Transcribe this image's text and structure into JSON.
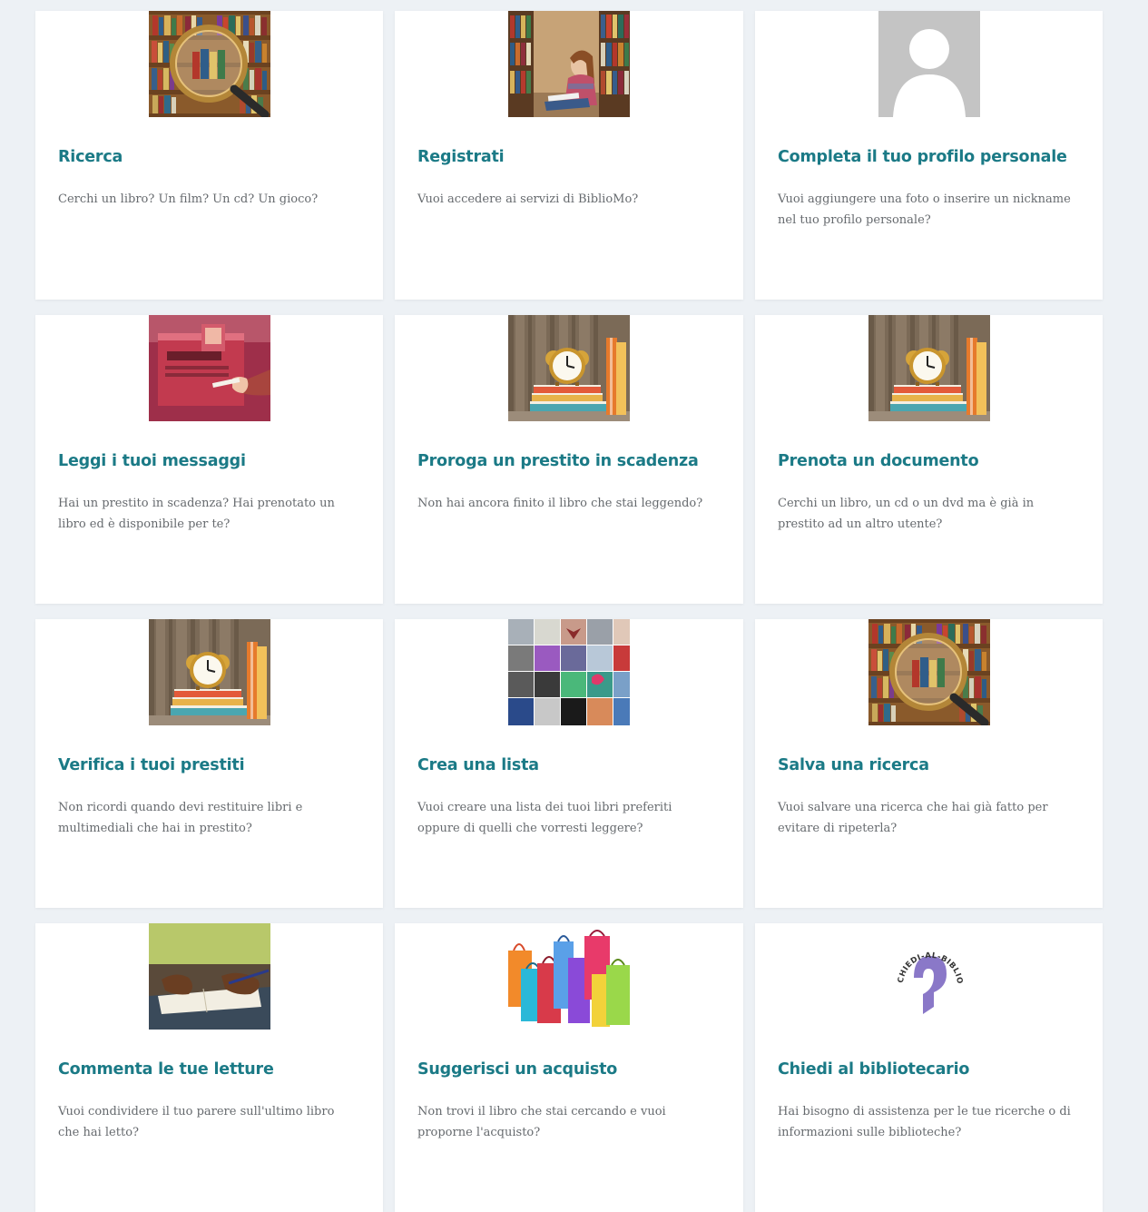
{
  "cards": [
    {
      "title": "Ricerca",
      "description": "Cerchi un libro? Un film? Un cd? Un gioco?",
      "icon": "bookshelf-magnifier-image"
    },
    {
      "title": "Registrati",
      "description": "Vuoi accedere ai servizi di BiblioMo?",
      "icon": "woman-reading-in-library-image"
    },
    {
      "title": "Completa il tuo profilo personale",
      "description": "Vuoi aggiungere una foto o inserire un nickname nel tuo profilo personale?",
      "icon": "default-avatar-image"
    },
    {
      "title": "Leggi i tuoi messaggi",
      "description": "Hai un prestito in scadenza? Hai prenotato un libro ed è disponibile per te?",
      "icon": "red-mailbox-image"
    },
    {
      "title": "Proroga un prestito in scadenza",
      "description": "Non hai ancora finito il libro che stai leggendo?",
      "icon": "alarm-clock-on-books-image"
    },
    {
      "title": "Prenota un documento",
      "description": "Cerchi un libro, un cd o un dvd ma è già in prestito ad un altro utente?",
      "icon": "alarm-clock-on-books-image"
    },
    {
      "title": "Verifica i tuoi prestiti",
      "description": "Non ricordi quando devi restituire libri e multimediali che hai in prestito?",
      "icon": "alarm-clock-on-books-image"
    },
    {
      "title": "Crea una lista",
      "description": "Vuoi creare una lista dei tuoi libri preferiti oppure di quelli che vorresti leggere?",
      "icon": "photo-collage-image"
    },
    {
      "title": "Salva una ricerca",
      "description": "Vuoi salvare una ricerca che hai già fatto per evitare di ripeterla?",
      "icon": "bookshelf-magnifier-image"
    },
    {
      "title": "Commenta le tue letture",
      "description": "Vuoi condividere il tuo parere sull'ultimo libro che hai letto?",
      "icon": "hands-writing-image"
    },
    {
      "title": "Suggerisci un acquisto",
      "description": "Non trovi il libro che stai cercando e vuoi proporne l'acquisto?",
      "icon": "shopping-bags-image"
    },
    {
      "title": "Chiedi al bibliotecario",
      "description": "Hai bisogno di assistenza per le tue ricerche o di informazioni sulle biblioteche?",
      "icon": "chiedi-al-bibliotecario-logo",
      "logo_text": "CHIEDI-AL-BIBLIOTECARIO"
    }
  ],
  "colors": {
    "title": "#1b7a86",
    "text": "#666a6e",
    "background": "#edf1f5",
    "card": "#ffffff"
  }
}
